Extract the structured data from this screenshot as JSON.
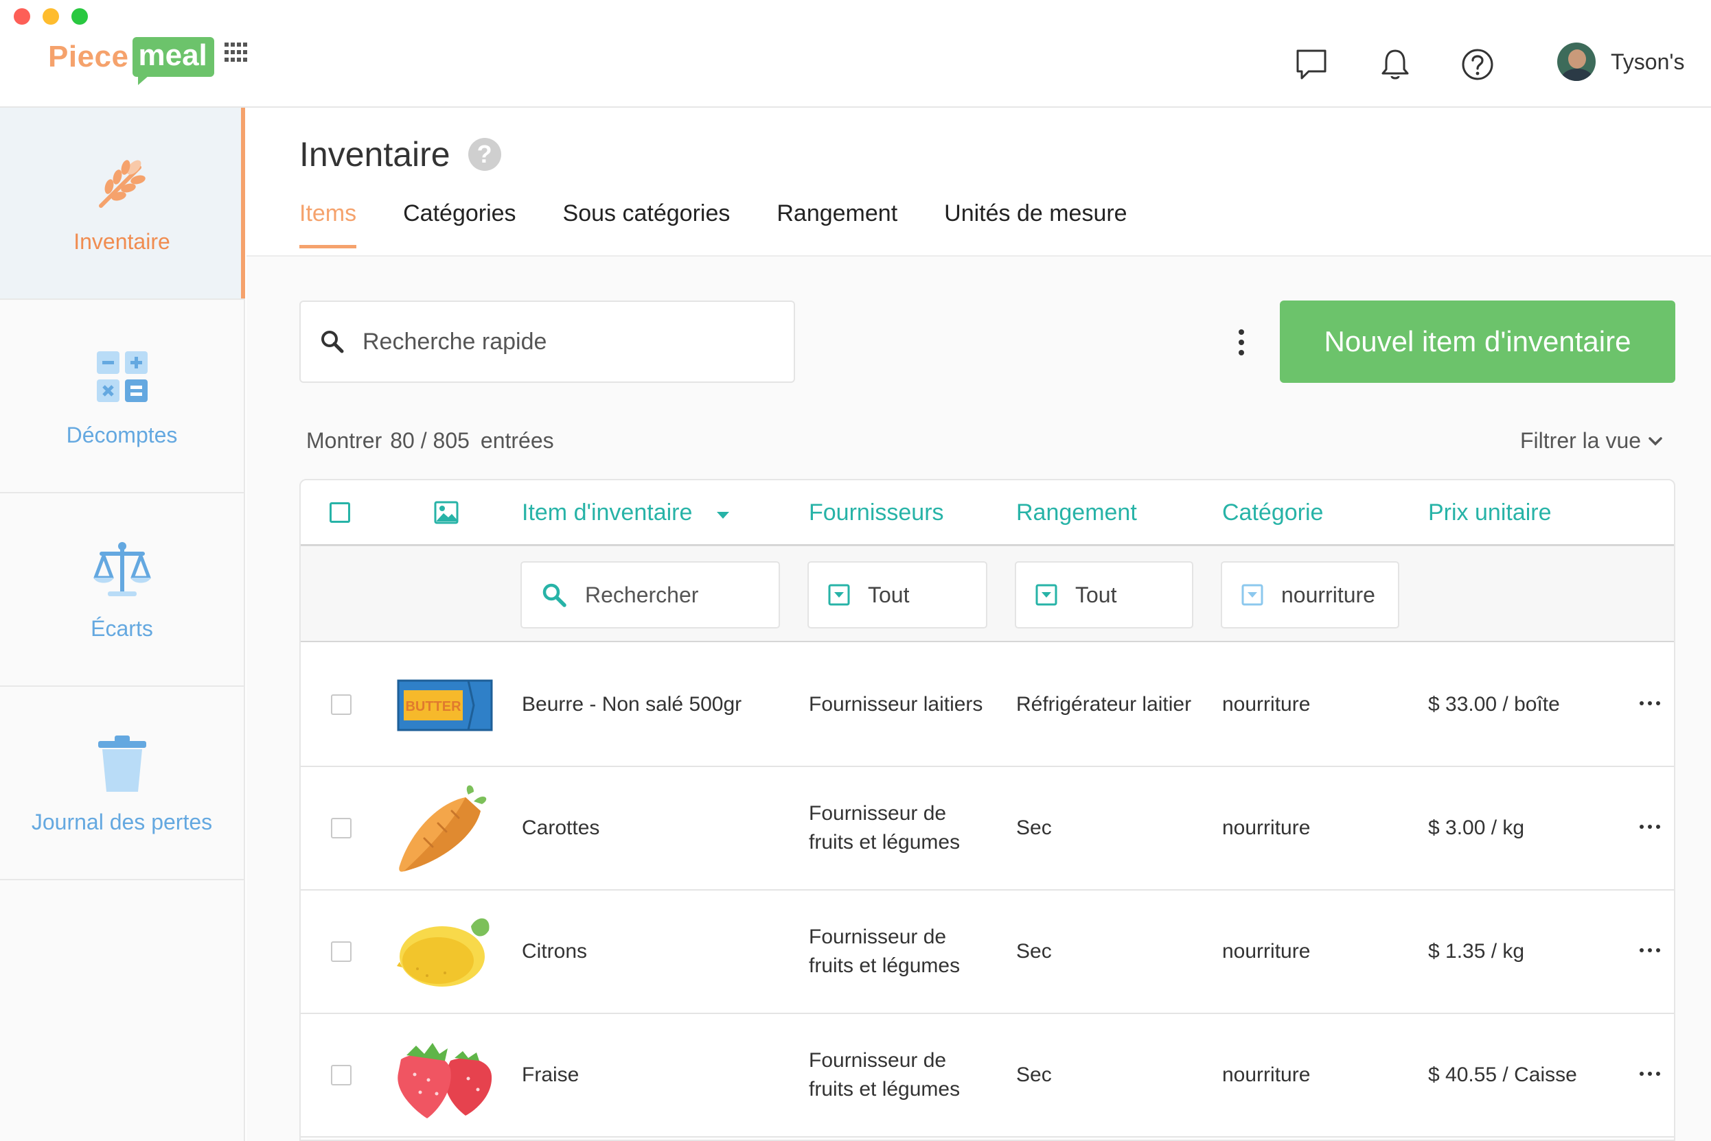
{
  "app": {
    "logo_part1": "Piece",
    "logo_part2": "meal",
    "user_name": "Tyson's"
  },
  "sidebar": {
    "items": [
      {
        "label": "Inventaire",
        "icon": "wheat-icon",
        "active": true
      },
      {
        "label": "Décomptes",
        "icon": "calculator-icon",
        "active": false
      },
      {
        "label": "Écarts",
        "icon": "scale-icon",
        "active": false
      },
      {
        "label": "Journal des pertes",
        "icon": "trash-icon",
        "active": false
      }
    ]
  },
  "page": {
    "title": "Inventaire",
    "help_glyph": "?",
    "tabs": [
      {
        "label": "Items",
        "active": true
      },
      {
        "label": "Catégories",
        "active": false
      },
      {
        "label": "Sous catégories",
        "active": false
      },
      {
        "label": "Rangement",
        "active": false
      },
      {
        "label": "Unités de mesure",
        "active": false
      }
    ]
  },
  "toolbar": {
    "search_placeholder": "Recherche rapide",
    "new_button": "Nouvel item d'inventaire"
  },
  "entries": {
    "prefix": "Montrer",
    "count": "80 / 805",
    "suffix": "entrées",
    "filter_view": "Filtrer la vue"
  },
  "table": {
    "columns": {
      "item": "Item d'inventaire",
      "suppliers": "Fournisseurs",
      "storage": "Rangement",
      "category": "Catégorie",
      "price": "Prix unitaire"
    },
    "filters": {
      "item_placeholder": "Rechercher",
      "suppliers": "Tout",
      "storage": "Tout",
      "category": "nourriture"
    },
    "rows": [
      {
        "name": "Beurre - Non salé 500gr",
        "supplier_l1": "Fournisseur laitiers",
        "supplier_l2": "",
        "storage": "Réfrigérateur laitier",
        "category": "nourriture",
        "price": "$ 33.00 / boîte",
        "image": "butter-icon",
        "image_text": "BUTTER"
      },
      {
        "name": "Carottes",
        "supplier_l1": "Fournisseur de",
        "supplier_l2": "fruits et légumes",
        "storage": "Sec",
        "category": "nourriture",
        "price": "$ 3.00 / kg",
        "image": "carrot-icon"
      },
      {
        "name": "Citrons",
        "supplier_l1": "Fournisseur de",
        "supplier_l2": "fruits et légumes",
        "storage": "Sec",
        "category": "nourriture",
        "price": "$ 1.35 / kg",
        "image": "lemon-icon"
      },
      {
        "name": "Fraise",
        "supplier_l1": "Fournisseur de",
        "supplier_l2": "fruits et légumes",
        "storage": "Sec",
        "category": "nourriture",
        "price": "$ 40.55 / Caisse",
        "image": "strawberry-icon"
      }
    ]
  },
  "colors": {
    "brand_orange": "#f5a26c",
    "brand_green": "#6cc36b",
    "teal": "#27b3a7",
    "sidebar_blue": "#64a8e0"
  }
}
